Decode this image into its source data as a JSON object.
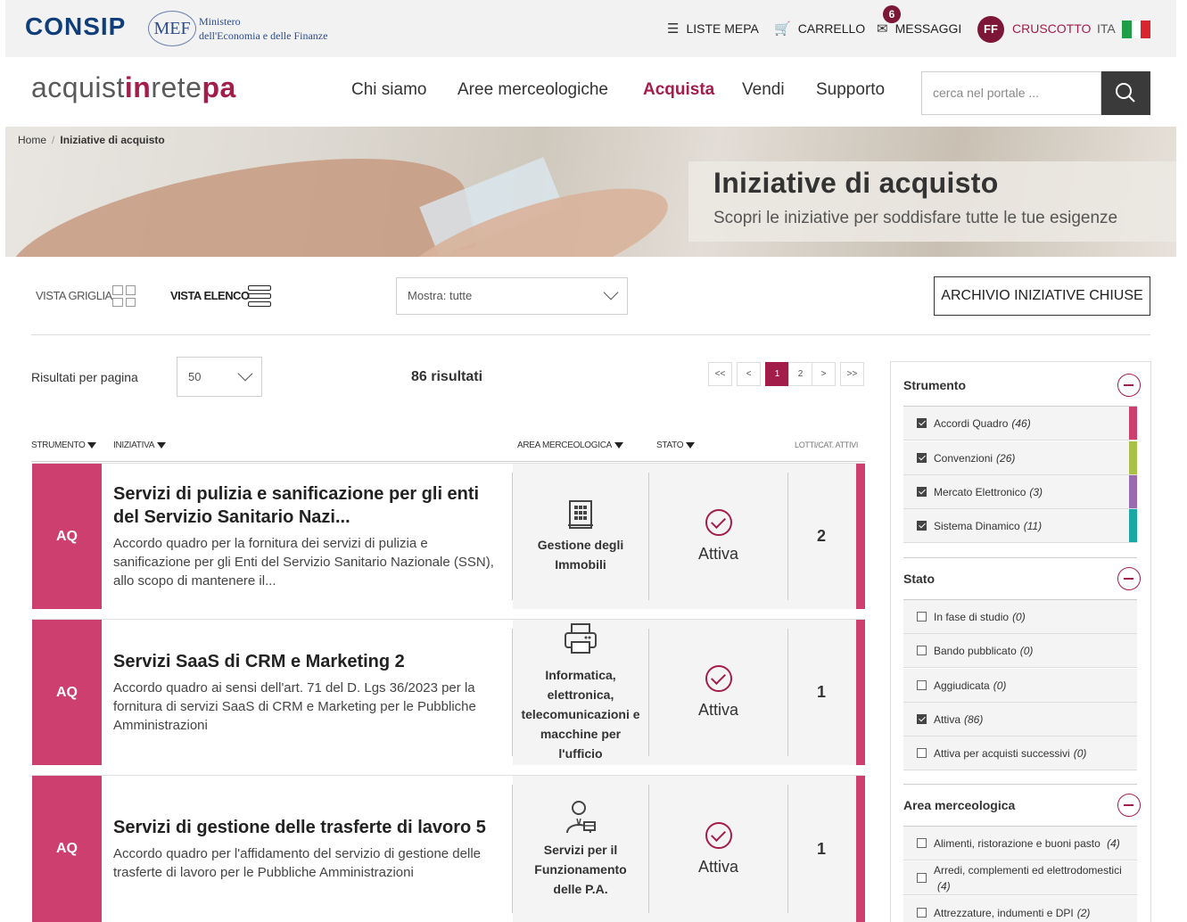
{
  "topbar": {
    "consip": "CONSIP",
    "mef": "MEF",
    "mef_line1": "Ministero",
    "mef_line2": "dell'Economia e delle Finanze",
    "liste_mepa": "LISTE MEPA",
    "carrello": "CARRELLO",
    "messaggi": "MESSAGGI",
    "messaggi_badge": "6",
    "avatar": "FF",
    "cruscotto": "CRUSCOTTO",
    "lang": "ITA",
    "flag_colors": [
      "#1f9e48",
      "#ffffff",
      "#d7262d"
    ]
  },
  "header": {
    "logo_a": "acquist",
    "logo_b": "in",
    "logo_c": "rete",
    "logo_d": "pa",
    "nav": [
      "Chi siamo",
      "Aree merceologiche",
      "Acquista",
      "Vendi",
      "Supporto"
    ],
    "active_nav": "Acquista",
    "search_placeholder": "cerca nel portale ..."
  },
  "breadcrumb": {
    "home": "Home",
    "current": "Iniziative di acquisto"
  },
  "banner": {
    "title": "Iniziative di acquisto",
    "subtitle": "Scopri le iniziative per soddisfare tutte le tue esigenze"
  },
  "controls": {
    "vista_griglia": "VISTA GRIGLIA",
    "vista_elenco": "VISTA ELENCO",
    "mostra": "Mostra: tutte",
    "archivio": "ARCHIVIO INIZIATIVE CHIUSE",
    "risultati_per_pagina": "Risultati per pagina",
    "per_page_value": "50",
    "results": "86 risultati",
    "pager": [
      "<<",
      "<",
      "1",
      "2",
      ">",
      ">>"
    ],
    "current_page": "1"
  },
  "table": {
    "headers": {
      "strumento": "STRUMENTO",
      "iniziativa": "INIZIATIVA",
      "area": "AREA MERCEOLOGICA",
      "stato": "STATO",
      "lotti": "LOTTI/CAT. ATTIVI"
    },
    "rows": [
      {
        "tag": "AQ",
        "title": "Servizi di pulizia e sanificazione per gli enti del Servizio Sanitario Nazi...",
        "desc": "Accordo quadro per la fornitura dei servizi di pulizia e sanificazione per gli Enti del Servizio Sanitario Nazionale (SSN), allo scopo di mantenere il...",
        "area": "Gestione degli Immobili",
        "area_icon": "building-icon",
        "stato": "Attiva",
        "lotti": "2"
      },
      {
        "tag": "AQ",
        "title": "Servizi SaaS di CRM e Marketing 2",
        "desc": "Accordo quadro ai sensi dell'art. 71 del D. Lgs 36/2023 per la fornitura di servizi SaaS di CRM e Marketing per le Pubbliche Amministrazioni",
        "area": "Informatica, elettronica, telecomunicazioni e macchine per l'ufficio",
        "area_icon": "printer-icon",
        "stato": "Attiva",
        "lotti": "1"
      },
      {
        "tag": "AQ",
        "title": "Servizi di gestione delle trasferte di lavoro 5",
        "desc": "Accordo quadro per l'affidamento del servizio di gestione delle trasferte di lavoro per le Pubbliche Amministrazioni",
        "area": "Servizi per il Funzionamento delle P.A.",
        "area_icon": "clerk-icon",
        "stato": "Attiva",
        "lotti": "1"
      }
    ]
  },
  "sidebar": {
    "strumento": {
      "title": "Strumento",
      "items": [
        {
          "label": "Accordi Quadro",
          "count": "(46)",
          "checked": true,
          "color": "#cc3f6f"
        },
        {
          "label": "Convenzioni",
          "count": "(26)",
          "checked": true,
          "color": "#a9c149"
        },
        {
          "label": "Mercato Elettronico",
          "count": "(3)",
          "checked": true,
          "color": "#9b6bb0"
        },
        {
          "label": "Sistema Dinamico",
          "count": "(11)",
          "checked": true,
          "color": "#19a8a5"
        }
      ]
    },
    "stato": {
      "title": "Stato",
      "items": [
        {
          "label": "In fase di studio",
          "count": "(0)",
          "checked": false
        },
        {
          "label": "Bando pubblicato",
          "count": "(0)",
          "checked": false
        },
        {
          "label": "Aggiudicata",
          "count": "(0)",
          "checked": false
        },
        {
          "label": "Attiva",
          "count": "(86)",
          "checked": true
        },
        {
          "label": "Attiva per acquisti successivi",
          "count": "(0)",
          "checked": false
        }
      ]
    },
    "area": {
      "title": "Area merceologica",
      "items": [
        {
          "label": "Alimenti, ristorazione e buoni pasto",
          "count": "(4)",
          "checked": false
        },
        {
          "label": "Arredi, complementi ed elettrodomestici",
          "count": "(4)",
          "checked": false
        },
        {
          "label": "Attrezzature, indumenti e DPI",
          "count": "(2)",
          "checked": false
        }
      ]
    }
  }
}
